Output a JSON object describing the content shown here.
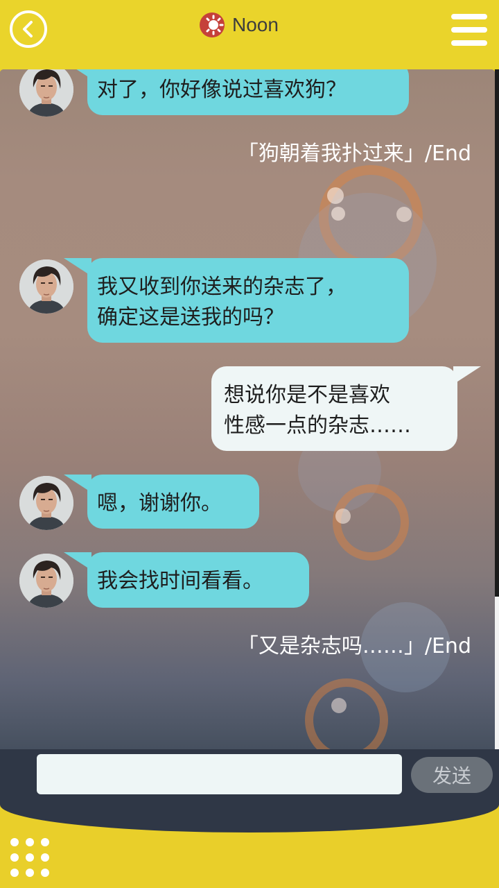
{
  "header": {
    "time_label": "Noon",
    "colors": {
      "bar": "#ead42b",
      "sun": "#c5413a"
    }
  },
  "messages": [
    {
      "side": "left",
      "text": "对了，你好像说过喜欢狗？"
    },
    {
      "side": "choice",
      "text": "「狗朝着我扑过来」/End"
    },
    {
      "side": "left",
      "lines": [
        "我又收到你送来的杂志了，",
        "确定这是送我的吗？"
      ]
    },
    {
      "side": "right",
      "lines": [
        "想说你是不是喜欢",
        "性感一点的杂志……"
      ]
    },
    {
      "side": "left",
      "text": "嗯，谢谢你。"
    },
    {
      "side": "left",
      "text": "我会找时间看看。"
    },
    {
      "side": "choice",
      "text": "「又是杂志吗……」/End"
    }
  ],
  "input": {
    "value": "",
    "placeholder": ""
  },
  "send_label": "发送",
  "colors": {
    "left_bubble": "#6fd7df",
    "right_bubble": "#eff6f6",
    "input_bar": "#2f3746"
  }
}
